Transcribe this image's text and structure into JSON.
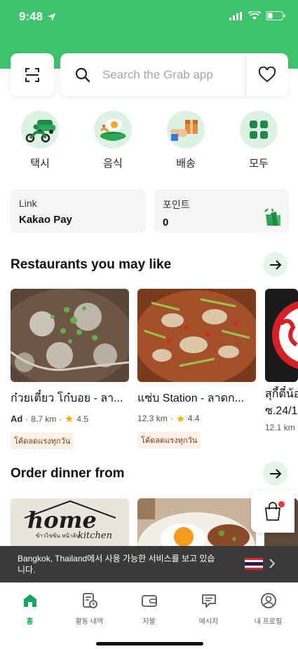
{
  "status_bar": {
    "time": "9:48"
  },
  "search": {
    "placeholder": "Search the Grab app"
  },
  "services": [
    {
      "label": "택시",
      "icon": "motorbike-car-icon"
    },
    {
      "label": "음식",
      "icon": "food-bowl-icon"
    },
    {
      "label": "배송",
      "icon": "parcel-hand-icon"
    },
    {
      "label": "모두",
      "icon": "grid-icon"
    }
  ],
  "cards": {
    "link": {
      "title": "Link",
      "value": "Kakao Pay"
    },
    "points": {
      "title": "포인트",
      "value": "0"
    }
  },
  "restaurants": {
    "title": "Restaurants you may like",
    "items": [
      {
        "name": "ก๋วยเตี๋ยว โก๋บอย - ลา...",
        "ad": "Ad",
        "distance": "8.7 km",
        "rating": "4.5",
        "tag": "โค้ดลดแรงทุกวัน"
      },
      {
        "name": "แซ่บ Station - ลาดก...",
        "ad": "",
        "distance": "12.3 km",
        "rating": "4.4",
        "tag": "โค้ดลดแรงทุกวัน"
      },
      {
        "name": "สุกี้ตี๋น้อ",
        "line2": "ซ.24/1",
        "distance": "12.1 km"
      }
    ]
  },
  "dinner": {
    "title": "Order dinner from",
    "logo_text": "home",
    "logo_sub": "kitchen",
    "logo_thai": "ข้าวไข่ข้น หน้าล้น"
  },
  "banner": {
    "text": "Bangkok, Thailand에서 사용 가능한 서비스를 보고 있습니다."
  },
  "tabs": [
    {
      "label": "홈",
      "icon": "home-icon",
      "active": true
    },
    {
      "label": "활동 내역",
      "icon": "activity-icon",
      "active": false
    },
    {
      "label": "지불",
      "icon": "wallet-icon",
      "active": false
    },
    {
      "label": "메시지",
      "icon": "message-icon",
      "active": false
    },
    {
      "label": "내 프로필",
      "icon": "profile-icon",
      "active": false
    }
  ],
  "colors": {
    "brand_green": "#3dc46a",
    "active_green": "#1aa65a",
    "banner_bg": "#3a3a3a"
  }
}
